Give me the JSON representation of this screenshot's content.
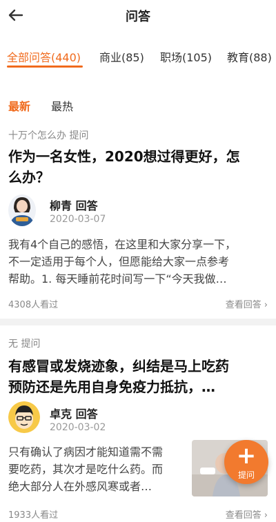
{
  "header": {
    "title": "问答"
  },
  "tabs": [
    {
      "label": "全部问答(440)"
    },
    {
      "label": "商业(85)"
    },
    {
      "label": "职场(105)"
    },
    {
      "label": "教育(88)"
    }
  ],
  "sort": {
    "latest": "最新",
    "hottest": "最热"
  },
  "questions": [
    {
      "asker": "十万个怎么办 提问",
      "title_line1": "作为一名女性，2020想过得更好，怎",
      "title_line2": "么办？",
      "answerer": "柳青 回答",
      "date": "2020-03-07",
      "excerpt_line1": "我有4个自己的感悟，在这里和大家分享一下，",
      "excerpt_line2": "不一定适用于每个人，但愿能给大家一点参考",
      "excerpt_line3": "帮助。1. 每天睡前花时间写一下“今天我做…",
      "views": "4308人看过",
      "more": "查看回答"
    },
    {
      "asker": "无 提问",
      "title_line1": "有感冒或发烧迹象，纠结是马上吃药",
      "title_line2": "预防还是先用自身免疫力抵抗，…",
      "answerer": "卓克 回答",
      "date": "2020-03-02",
      "excerpt_line1": "只有确认了病因才能知道需不需",
      "excerpt_line2": "要吃药，其次才是吃什么药。而",
      "excerpt_line3": "绝大部分人在外感风寒或者…",
      "views": "1933人看过",
      "more": "查看回答"
    }
  ],
  "fab": {
    "label": "提问"
  },
  "colors": {
    "accent": "#f06a1c",
    "fab": "#f27a2e"
  }
}
